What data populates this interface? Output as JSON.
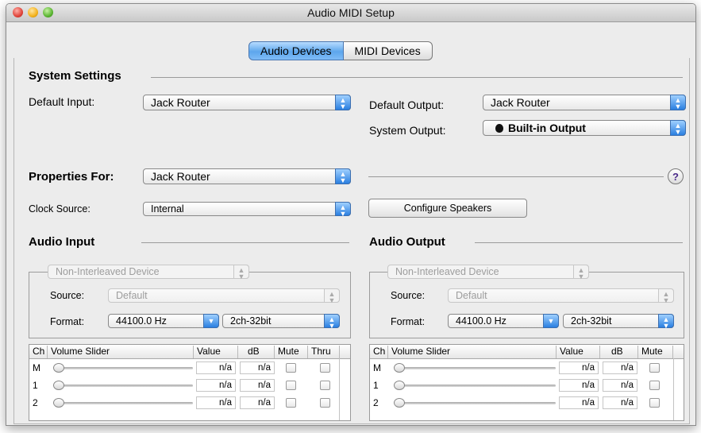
{
  "window": {
    "title": "Audio MIDI Setup"
  },
  "tabs": [
    {
      "label": "Audio Devices",
      "active": true
    },
    {
      "label": "MIDI Devices",
      "active": false
    }
  ],
  "system_settings": {
    "heading": "System Settings",
    "default_input_label": "Default Input:",
    "default_input_value": "Jack Router",
    "default_output_label": "Default Output:",
    "default_output_value": "Jack Router",
    "system_output_label": "System Output:",
    "system_output_value": "Built-in Output"
  },
  "properties": {
    "label": "Properties For:",
    "value": "Jack Router",
    "help": "?",
    "clock_source_label": "Clock Source:",
    "clock_source_value": "Internal",
    "configure_speakers": "Configure Speakers"
  },
  "audio_input": {
    "heading": "Audio Input",
    "device_mode": "Non-Interleaved Device",
    "source_label": "Source:",
    "source_value": "Default",
    "format_label": "Format:",
    "format_rate": "44100.0 Hz",
    "format_bits": "2ch-32bit",
    "columns": [
      "Ch",
      "Volume Slider",
      "Value",
      "dB",
      "Mute",
      "Thru"
    ],
    "rows": [
      {
        "ch": "M",
        "value": "n/a",
        "db": "n/a"
      },
      {
        "ch": "1",
        "value": "n/a",
        "db": "n/a"
      },
      {
        "ch": "2",
        "value": "n/a",
        "db": "n/a"
      }
    ]
  },
  "audio_output": {
    "heading": "Audio Output",
    "device_mode": "Non-Interleaved Device",
    "source_label": "Source:",
    "source_value": "Default",
    "format_label": "Format:",
    "format_rate": "44100.0 Hz",
    "format_bits": "2ch-32bit",
    "columns": [
      "Ch",
      "Volume Slider",
      "Value",
      "dB",
      "Mute"
    ],
    "rows": [
      {
        "ch": "M",
        "value": "n/a",
        "db": "n/a"
      },
      {
        "ch": "1",
        "value": "n/a",
        "db": "n/a"
      },
      {
        "ch": "2",
        "value": "n/a",
        "db": "n/a"
      }
    ]
  },
  "icons": {
    "popup": "up-down-arrows-icon",
    "apple": "apple-logo-icon",
    "help": "question-mark-icon"
  }
}
